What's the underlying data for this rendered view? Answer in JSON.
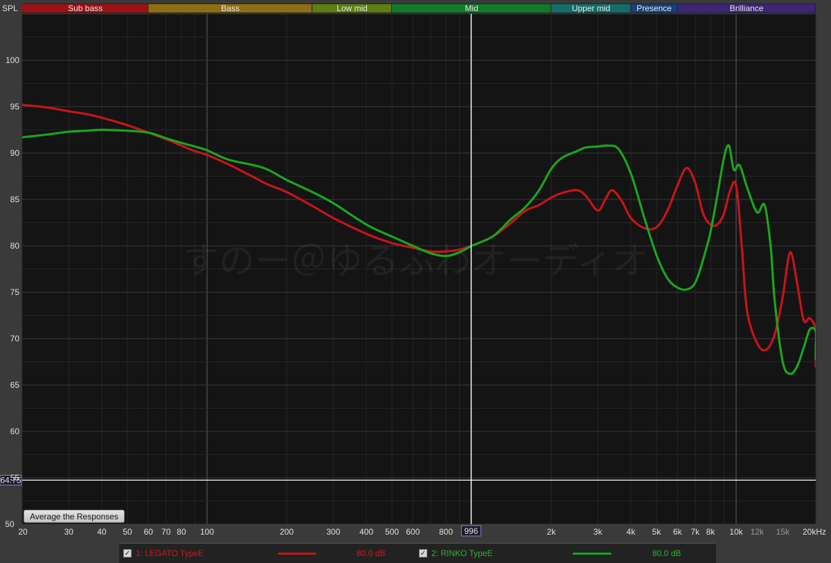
{
  "app": {
    "y_axis_title": "SPL",
    "watermark": "すのー＠ゆるふわオーディオ",
    "average_button_label": "Average the Responses",
    "cursor_freq_label": "996",
    "cursor_level_label": "64.75",
    "cursor_level_value": 54.75,
    "cursor_freq_value": 996
  },
  "colors": {
    "background": "#141414",
    "grid_major": "#3a3a3a",
    "grid_minor": "#262626",
    "series_1": "#c8131b",
    "series_2": "#1aa51e"
  },
  "bands": [
    {
      "label": "Sub bass",
      "from": 20,
      "to": 60,
      "color": "#9b1116"
    },
    {
      "label": "Bass",
      "from": 60,
      "to": 250,
      "color": "#8e6e14"
    },
    {
      "label": "Low mid",
      "from": 250,
      "to": 500,
      "color": "#5f7d12"
    },
    {
      "label": "Mid",
      "from": 500,
      "to": 2000,
      "color": "#127a2c"
    },
    {
      "label": "Upper mid",
      "from": 2000,
      "to": 4000,
      "color": "#136d6b"
    },
    {
      "label": "Presence",
      "from": 4000,
      "to": 6000,
      "color": "#18407a"
    },
    {
      "label": "Brilliance",
      "from": 6000,
      "to": 20000,
      "color": "#3c2575"
    }
  ],
  "chart_data": {
    "type": "line",
    "xscale": "log",
    "xlim": [
      20,
      20000
    ],
    "ylim": [
      50,
      105
    ],
    "grid": true,
    "legend_placement": "bottom",
    "ylabel": "SPL",
    "xlabel": "",
    "x_ticks": [
      {
        "value": 20,
        "label": "20"
      },
      {
        "value": 30,
        "label": "30"
      },
      {
        "value": 40,
        "label": "40"
      },
      {
        "value": 50,
        "label": "50"
      },
      {
        "value": 60,
        "label": "60"
      },
      {
        "value": 70,
        "label": "70"
      },
      {
        "value": 80,
        "label": "80"
      },
      {
        "value": 100,
        "label": "100"
      },
      {
        "value": 200,
        "label": "200"
      },
      {
        "value": 300,
        "label": "300"
      },
      {
        "value": 400,
        "label": "400"
      },
      {
        "value": 500,
        "label": "500"
      },
      {
        "value": 600,
        "label": "600"
      },
      {
        "value": 800,
        "label": "800"
      },
      {
        "value": 2000,
        "label": "2k"
      },
      {
        "value": 3000,
        "label": "3k"
      },
      {
        "value": 4000,
        "label": "4k"
      },
      {
        "value": 5000,
        "label": "5k"
      },
      {
        "value": 6000,
        "label": "6k"
      },
      {
        "value": 7000,
        "label": "7k"
      },
      {
        "value": 8000,
        "label": "8k"
      },
      {
        "value": 10000,
        "label": "10k"
      },
      {
        "value": 12000,
        "label": "12k",
        "dim": true
      },
      {
        "value": 15000,
        "label": "15k",
        "dim": true
      },
      {
        "value": 20000,
        "label": "20kHz"
      }
    ],
    "y_ticks": [
      50,
      55,
      60,
      65,
      70,
      75,
      80,
      85,
      90,
      95,
      100
    ],
    "series": [
      {
        "name": "1: LEGATO TypeE",
        "level_label": "80.0 dB",
        "color": "#c8131b",
        "points": [
          [
            20,
            95.2
          ],
          [
            25,
            94.9
          ],
          [
            30,
            94.5
          ],
          [
            35,
            94.2
          ],
          [
            40,
            93.8
          ],
          [
            50,
            93.0
          ],
          [
            60,
            92.2
          ],
          [
            70,
            91.5
          ],
          [
            80,
            90.8
          ],
          [
            90,
            90.2
          ],
          [
            100,
            89.8
          ],
          [
            120,
            88.8
          ],
          [
            150,
            87.4
          ],
          [
            170,
            86.6
          ],
          [
            200,
            85.8
          ],
          [
            250,
            84.3
          ],
          [
            300,
            83.0
          ],
          [
            400,
            81.3
          ],
          [
            500,
            80.3
          ],
          [
            600,
            79.8
          ],
          [
            700,
            79.4
          ],
          [
            800,
            79.4
          ],
          [
            900,
            79.6
          ],
          [
            1000,
            80.0
          ],
          [
            1200,
            81.0
          ],
          [
            1400,
            82.4
          ],
          [
            1600,
            83.8
          ],
          [
            1800,
            84.4
          ],
          [
            2000,
            85.2
          ],
          [
            2200,
            85.7
          ],
          [
            2500,
            86.0
          ],
          [
            2700,
            85.4
          ],
          [
            3000,
            83.8
          ],
          [
            3200,
            85.0
          ],
          [
            3400,
            86.0
          ],
          [
            3700,
            84.8
          ],
          [
            4000,
            83.0
          ],
          [
            4500,
            81.9
          ],
          [
            5000,
            82.0
          ],
          [
            5500,
            83.8
          ],
          [
            6000,
            86.5
          ],
          [
            6500,
            88.4
          ],
          [
            7000,
            86.8
          ],
          [
            7500,
            83.5
          ],
          [
            8000,
            82.3
          ],
          [
            8500,
            82.3
          ],
          [
            9000,
            83.5
          ],
          [
            9500,
            86.0
          ],
          [
            10000,
            86.5
          ],
          [
            10500,
            80.0
          ],
          [
            11000,
            73.0
          ],
          [
            12000,
            69.5
          ],
          [
            13000,
            68.8
          ],
          [
            14000,
            70.5
          ],
          [
            15000,
            74.5
          ],
          [
            16000,
            79.3
          ],
          [
            17000,
            76.0
          ],
          [
            18000,
            72.0
          ],
          [
            19000,
            72.2
          ],
          [
            20000,
            71.0
          ],
          [
            21000,
            68.5
          ],
          [
            22000,
            67.0
          ]
        ]
      },
      {
        "name": "2: RINKO TypeE",
        "level_label": "80.0 dB",
        "color": "#1aa51e",
        "points": [
          [
            20,
            91.7
          ],
          [
            25,
            92.0
          ],
          [
            30,
            92.3
          ],
          [
            35,
            92.4
          ],
          [
            40,
            92.5
          ],
          [
            50,
            92.4
          ],
          [
            60,
            92.2
          ],
          [
            70,
            91.6
          ],
          [
            80,
            91.1
          ],
          [
            90,
            90.7
          ],
          [
            100,
            90.3
          ],
          [
            120,
            89.3
          ],
          [
            150,
            88.7
          ],
          [
            170,
            88.2
          ],
          [
            200,
            87.1
          ],
          [
            250,
            85.8
          ],
          [
            300,
            84.6
          ],
          [
            400,
            82.3
          ],
          [
            500,
            81.0
          ],
          [
            600,
            80.0
          ],
          [
            700,
            79.2
          ],
          [
            800,
            78.9
          ],
          [
            900,
            79.3
          ],
          [
            1000,
            80.0
          ],
          [
            1200,
            81.0
          ],
          [
            1400,
            82.8
          ],
          [
            1600,
            84.2
          ],
          [
            1800,
            86.0
          ],
          [
            2000,
            88.3
          ],
          [
            2200,
            89.5
          ],
          [
            2500,
            90.2
          ],
          [
            2700,
            90.6
          ],
          [
            3000,
            90.7
          ],
          [
            3300,
            90.8
          ],
          [
            3600,
            90.4
          ],
          [
            4000,
            87.8
          ],
          [
            4500,
            83.0
          ],
          [
            5000,
            79.0
          ],
          [
            5500,
            76.5
          ],
          [
            6000,
            75.5
          ],
          [
            6500,
            75.3
          ],
          [
            7000,
            76.0
          ],
          [
            7500,
            78.5
          ],
          [
            8000,
            81.5
          ],
          [
            8500,
            85.5
          ],
          [
            9000,
            89.5
          ],
          [
            9400,
            90.8
          ],
          [
            9800,
            88.2
          ],
          [
            10300,
            88.7
          ],
          [
            11000,
            86.3
          ],
          [
            12000,
            83.6
          ],
          [
            12800,
            84.4
          ],
          [
            13500,
            80.0
          ],
          [
            14000,
            74.0
          ],
          [
            15000,
            67.5
          ],
          [
            16000,
            66.2
          ],
          [
            17000,
            67.0
          ],
          [
            18000,
            69.0
          ],
          [
            19000,
            71.0
          ],
          [
            20000,
            70.8
          ],
          [
            21000,
            69.0
          ],
          [
            22000,
            67.8
          ]
        ]
      }
    ]
  }
}
